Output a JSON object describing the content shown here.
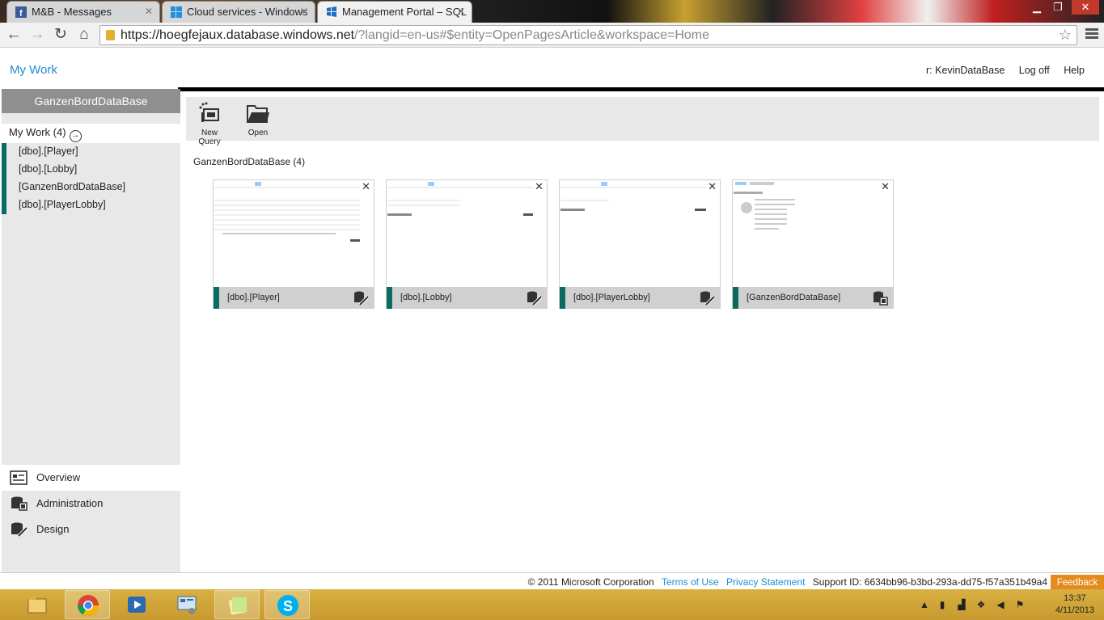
{
  "browser": {
    "tabs": [
      {
        "label": "M&B - Messages",
        "icon": "facebook-icon"
      },
      {
        "label": "Cloud services - Windows",
        "icon": "windows-icon"
      },
      {
        "label": "Management Portal – SQL",
        "icon": "windows-azure-icon"
      }
    ],
    "url_host": "https://hoegfejaux.database.windows.net",
    "url_rest": "/?langid=en-us#$entity=OpenPagesArticle&workspace=Home"
  },
  "header": {
    "title": "My Work",
    "user": "r: KevinDataBase",
    "logoff": "Log off",
    "help": "Help"
  },
  "sidebar": {
    "database": "GanzenBordDataBase",
    "mywork": "My Work (4)",
    "items": [
      "[dbo].[Player]",
      "[dbo].[Lobby]",
      "[GanzenBordDataBase]",
      "[dbo].[PlayerLobby]"
    ],
    "nav": [
      "Overview",
      "Administration",
      "Design"
    ]
  },
  "commands": {
    "new_query": "New Query",
    "open": "Open"
  },
  "main": {
    "group_title": "GanzenBordDataBase (4)",
    "tiles": [
      {
        "label": "[dbo].[Player]"
      },
      {
        "label": "[dbo].[Lobby]"
      },
      {
        "label": "[dbo].[PlayerLobby]"
      },
      {
        "label": "[GanzenBordDataBase]"
      }
    ]
  },
  "footer": {
    "copyright": "© 2011 Microsoft Corporation",
    "terms": "Terms of Use",
    "privacy": "Privacy Statement",
    "support": "Support ID: 6634bb96-b3bd-293a-dd75-f57a351b49a4",
    "feedback": "Feedback"
  },
  "taskbar": {
    "time": "13:37",
    "date": "4/11/2013"
  },
  "colors": {
    "accent": "#1f8dd6",
    "tile_accent": "#0b6b61",
    "feedback": "#e48b1e"
  }
}
